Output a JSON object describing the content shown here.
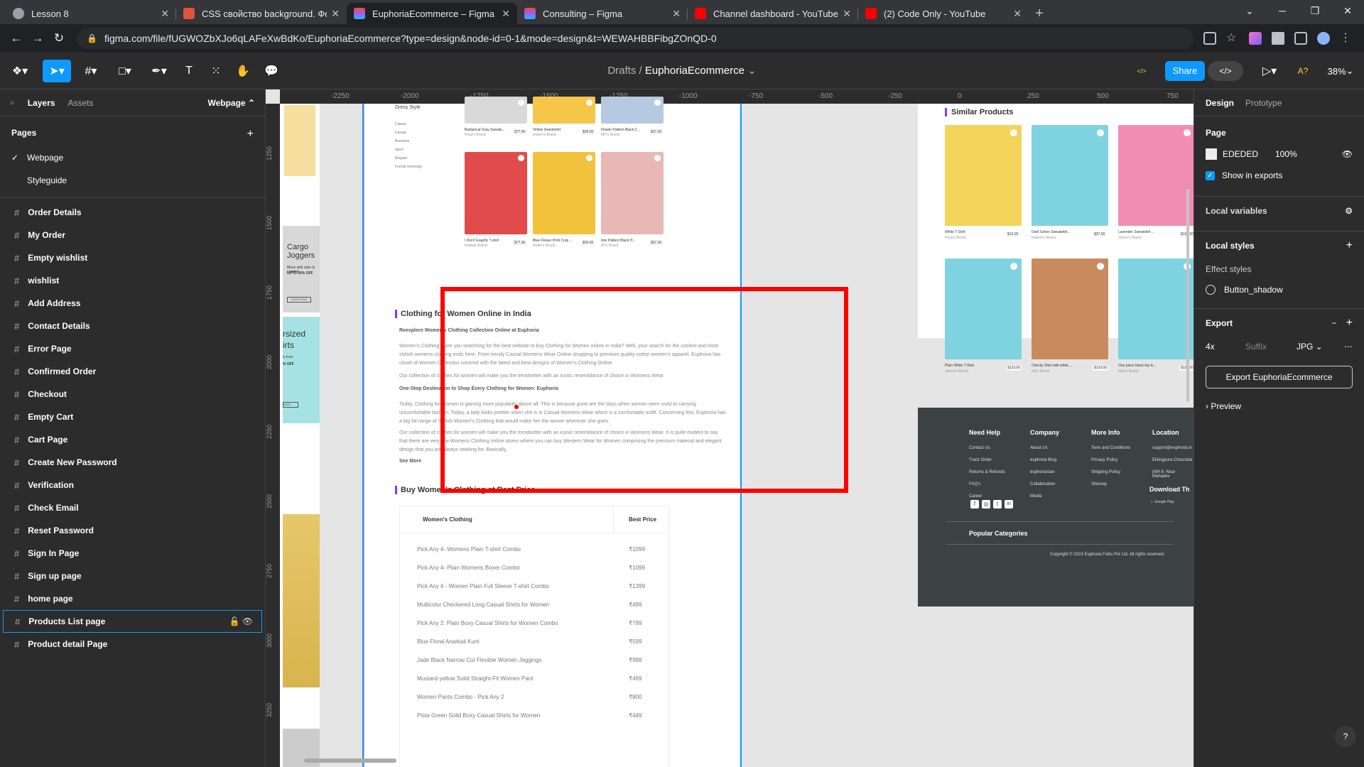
{
  "browser": {
    "tabs": [
      {
        "title": "Lesson 8",
        "fav": "#9aa0a6"
      },
      {
        "title": "CSS свойство background. Фон",
        "fav": "#e0533d"
      },
      {
        "title": "EuphoriaEcommerce – Figma",
        "fav": "#a259ff"
      },
      {
        "title": "Consulting – Figma",
        "fav": "#a259ff"
      },
      {
        "title": "Channel dashboard - YouTube S",
        "fav": "#ff0000"
      },
      {
        "title": "(2) Code Only - YouTube",
        "fav": "#ff0000"
      }
    ],
    "url": "figma.com/file/fUGWOZbXJo6qLAFeXwBdKo/EuphoriaEcommerce?type=design&node-id=0-1&mode=design&t=WEWAHBBFibgZOnQD-0"
  },
  "figma": {
    "crumb_drafts": "Drafts",
    "crumb_sep": "/",
    "file_name": "EuphoriaEcommerce",
    "share_label": "Share",
    "zoom": "38%",
    "left_tabs": {
      "layers": "Layers",
      "assets": "Assets",
      "page_select": "Webpage"
    },
    "pages_title": "Pages",
    "pages": [
      "Webpage",
      "Styleguide"
    ],
    "frames": [
      "Order Details",
      "My Order",
      "Empty wishlist",
      "wishlist",
      "Add Address",
      "Contact Details",
      "Error Page",
      "Confirmed Order",
      "Checkout",
      "Empty Cart",
      "Cart Page",
      "Create New Password",
      "Verification",
      "Check Email",
      "Reset Password",
      "Sign In Page",
      "Sign up page",
      "home page",
      "Products List page",
      "Product detail Page"
    ],
    "selected_frame": "Products List page",
    "right": {
      "tab_design": "Design",
      "tab_prototype": "Prototype",
      "page_label": "Page",
      "page_color": "EDEDED",
      "page_opacity": "100%",
      "show_exports": "Show in exports",
      "local_vars": "Local variables",
      "local_styles": "Local styles",
      "effect_styles": "Effect styles",
      "effect_item": "Button_shadow",
      "export_label": "Export",
      "export_scale": "4x",
      "export_suffix": "Suffix",
      "export_format": "JPG",
      "export_button": "Export EuphoriaEcommerce",
      "preview": "Preview"
    },
    "rulers_h": [
      "-2250",
      "-2000",
      "-1750",
      "-1500",
      "-1250",
      "-1000",
      "-750",
      "-500",
      "-250",
      "0",
      "250",
      "500",
      "750"
    ],
    "rulers_v": [
      "1250",
      "1500",
      "1750",
      "2000",
      "2250",
      "2500",
      "2750",
      "3000",
      "3250"
    ]
  },
  "canvas": {
    "promo1": {
      "title": "Cargo Joggers",
      "sub": "Move with style & comfort",
      "off": "UPTO 50% OFF",
      "btn": "SHOP NOW"
    },
    "promo2": {
      "title": "rsized irts",
      "sub": "ic Icon",
      "off": "% OFF",
      "btn": "NOW"
    },
    "dress_style": "Dress Style",
    "filters": [
      "Classic",
      "Casual",
      "Business",
      "Sport",
      "Elegant",
      "Formal (evening)"
    ],
    "row1": [
      {
        "name": "Barbarical Gray Sweats...",
        "brand": "Priya's Brand",
        "price": "$77.00"
      },
      {
        "name": "Yellow Sweatshirt",
        "brand": "woden's Brand",
        "price": "$39.00"
      },
      {
        "name": "Flower Pattern Black C...",
        "brand": "MH's Brand",
        "price": "$37.00"
      }
    ],
    "row2": [
      {
        "name": "I Don't Graphic T-shirt",
        "brand": "Raleigh Brand",
        "price": "$77.00"
      },
      {
        "name": "Blue Flower Print Crop ...",
        "brand": "Nettie's Brand",
        "price": "$29.00"
      },
      {
        "name": "Inte Pattern Black H...",
        "brand": "AT's Brand",
        "price": "$37.00"
      }
    ],
    "article": {
      "h1": "Clothing for Women Online in India",
      "h2": "Reexplore Women's Clothing Collection Online at Euphoria",
      "p1": "Women's Clothing – Are you searching for the best website to buy Clothing for Women online in India? Well, your search for the coolest and most stylish womens clothing ends here. From trendy Casual Womens Wear Online shopping to premium quality cotton women's apparel, Euphoria has closet of Women Collection covered with the latest and best designs of Women's Clothing Online.",
      "p2": "Our collection of clothes for women will make you the trendsetter with an iconic resemblance of choice in Womens Wear.",
      "h3": "One-Stop Destination to Shop Every Clothing for Women: Euphoria",
      "p3": "Today, Clothing for Women is gaining more popularity above all. This is because gone are the days when women were used to carrying uncomfortable fashion. Today, a lady looks prettier when she is in Casual Womens Wear which is a comfortable outfit. Concerning this, Euphoria has a big fat range of Stylish Women's Clothing that would make her the winner wherever she goes.",
      "p4": "Our collection of clothes for women will make you the trendsetter with an iconic resemblance of choice in Womens Wear. It is quite evident to say that there are very few Womens Clothing online stores where you can buy Western Wear for Women comprising the premium material and elegant design that you are always seeking for. Basically,",
      "more": "See More"
    },
    "best_price": {
      "title": "Buy Women's Clothing at Best Price",
      "col1": "Women's Clothing",
      "col2": "Best Price",
      "rows": [
        {
          "n": "Pick Any 4- Womens Plain T-shirt Combo",
          "p": "₹1099"
        },
        {
          "n": "Pick Any 4- Plain Womens Boxer Combo",
          "p": "₹1099"
        },
        {
          "n": "Pick Any 4 - Women Plain Full Sleeve T-shirt Combo",
          "p": "₹1399"
        },
        {
          "n": "Multicolor Checkered Long Casual Shirts for Women",
          "p": "₹499"
        },
        {
          "n": "Pick Any 2: Plain Boxy Casual Shirts for Women Combo",
          "p": "₹799"
        },
        {
          "n": "Blue Floral Anarkali Kurti",
          "p": "₹599"
        },
        {
          "n": "Jade Black Narrow Cut Flexible Women Jeggings",
          "p": "₹998"
        },
        {
          "n": "Mustard-yellow Solid Straight-Fit Women Pant",
          "p": "₹499"
        },
        {
          "n": "Women Pants Combo - Pick Any 2",
          "p": "₹800"
        },
        {
          "n": "Pista Green Solid Boxy Casual Shirts for Women",
          "p": "₹449"
        }
      ]
    },
    "similar": {
      "title": "Similar Products",
      "items": [
        {
          "name": "White T-Shirt",
          "brand": "Priya's Brand",
          "price": "$13.00"
        },
        {
          "name": "Dark Green Sweatshirt...",
          "brand": "Nobela's Brand",
          "price": "$37.00"
        },
        {
          "name": "Lavender Sweatshirt ...",
          "brand": "Jhanvi's Brand",
          "price": "$120.00"
        },
        {
          "name": "Plain White T-Shirt",
          "brand": "Jhanvi's Brand",
          "price": "$123.00"
        },
        {
          "name": "Checky Shirt with white...",
          "brand": "Kiti's Brand",
          "price": "$123.00"
        },
        {
          "name": "One piece black top &...",
          "brand": "Nike's Brand",
          "price": "$123.00"
        }
      ]
    },
    "footer": {
      "cols": [
        {
          "h": "Need Help",
          "links": [
            "Contact Us",
            "Track Order",
            "Returns & Refunds",
            "FAQ's",
            "Career"
          ]
        },
        {
          "h": "Company",
          "links": [
            "About Us",
            "euphoria Blog",
            "euphoriastan",
            "Collaboration",
            "Media"
          ]
        },
        {
          "h": "More Info",
          "links": [
            "Term and Conditions",
            "Privacy Policy",
            "Shipping Policy",
            "Sitemap"
          ]
        },
        {
          "h": "Location",
          "links": [
            "support@euphoria.in",
            "Eklingpura Chouraha",
            "(NH 8- Near Mahadev"
          ]
        }
      ],
      "download": "Download Th",
      "store": "Google Play",
      "popular": "Popular Categories",
      "copyright": "Copyright © 2023 Euphoria Folks Pvt Ltd. All rights reserved."
    }
  }
}
